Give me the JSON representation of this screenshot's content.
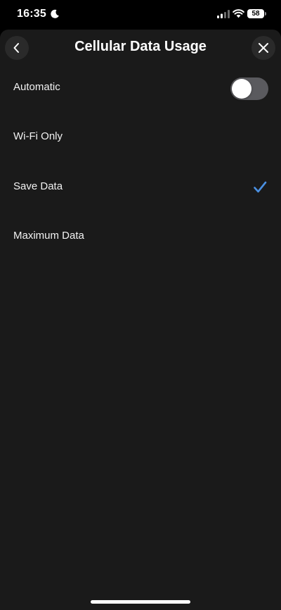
{
  "status_bar": {
    "time": "16:35",
    "battery": "58",
    "icons": [
      "moon-icon",
      "cellular-signal-icon",
      "wifi-icon",
      "battery-icon"
    ]
  },
  "header": {
    "title": "Cellular Data Usage",
    "back_icon": "chevron-left-icon",
    "close_icon": "close-icon"
  },
  "options": [
    {
      "label": "Automatic",
      "control": "toggle",
      "toggle_on": false
    },
    {
      "label": "Wi-Fi Only"
    },
    {
      "label": "Save Data",
      "selected": true,
      "icon": "checkmark-icon"
    },
    {
      "label": "Maximum Data"
    }
  ],
  "colors": {
    "background": "#1a1a1a",
    "accent": "#4a90e2",
    "toggle_off": "#5a5a5e"
  }
}
